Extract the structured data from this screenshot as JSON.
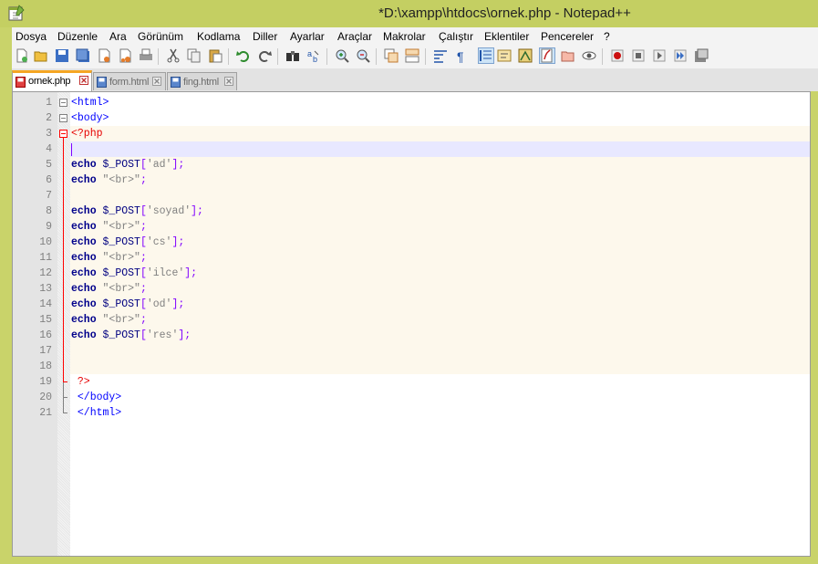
{
  "window": {
    "title": "*D:\\xampp\\htdocs\\ornek.php - Notepad++",
    "app_icon": "notepad-plus-plus-icon"
  },
  "menu": [
    "Dosya",
    "Düzenle",
    "Ara",
    "Görünüm",
    "Kodlama",
    "Diller",
    "Ayarlar",
    "Araçlar",
    "Makrolar",
    "Çalıştır",
    "Eklentiler",
    "Pencereler",
    "?"
  ],
  "toolbar": {
    "buttons": [
      "new-file-icon",
      "open-file-icon",
      "save-icon",
      "save-all-icon",
      "close-icon",
      "close-all-icon",
      "print-icon",
      "cut-icon",
      "copy-icon",
      "paste-icon",
      "undo-icon",
      "redo-icon",
      "find-icon",
      "replace-icon",
      "zoom-in-icon",
      "zoom-out-icon",
      "sync-vertical-icon",
      "sync-horizontal-icon",
      "word-wrap-icon",
      "show-all-chars-icon",
      "indent-guide-icon",
      "user-lang-icon",
      "doc-map-icon",
      "function-list-icon",
      "folder-workspace-icon",
      "monitor-icon",
      "record-macro-icon",
      "stop-record-icon",
      "play-macro-icon",
      "run-macro-multiple-icon",
      "save-macro-icon"
    ]
  },
  "tabs": [
    {
      "label": "ornek.php",
      "active": true
    },
    {
      "label": "form.html",
      "active": false
    },
    {
      "label": "fing.html",
      "active": false
    }
  ],
  "editor": {
    "current_line": 4,
    "lines": [
      {
        "n": "1",
        "text": "<html>"
      },
      {
        "n": "2",
        "text": "<body>"
      },
      {
        "n": "3",
        "text": "<?php"
      },
      {
        "n": "4",
        "text": ""
      },
      {
        "n": "5",
        "text": "echo $_POST['ad'];"
      },
      {
        "n": "6",
        "text": "echo \"<br>\";"
      },
      {
        "n": "7",
        "text": ""
      },
      {
        "n": "8",
        "text": "echo $_POST['soyad'];"
      },
      {
        "n": "9",
        "text": "echo \"<br>\";"
      },
      {
        "n": "10",
        "text": "echo $_POST['cs'];"
      },
      {
        "n": "11",
        "text": "echo \"<br>\";"
      },
      {
        "n": "12",
        "text": "echo $_POST['ilce'];"
      },
      {
        "n": "13",
        "text": "echo \"<br>\";"
      },
      {
        "n": "14",
        "text": "echo $_POST['od'];"
      },
      {
        "n": "15",
        "text": "echo \"<br>\";"
      },
      {
        "n": "16",
        "text": "echo $_POST['res'];"
      },
      {
        "n": "17",
        "text": ""
      },
      {
        "n": "18",
        "text": ""
      },
      {
        "n": "19",
        "text": " ?>"
      },
      {
        "n": "20",
        "text": " </body>"
      },
      {
        "n": "21",
        "text": " </html>"
      }
    ]
  },
  "colors": {
    "titlebar": "#c4cf62",
    "keyword": "#00008b",
    "tag": "#0000ff",
    "php_delimiter": "#e60000",
    "string": "#808080",
    "current_line": "#e8e8ff",
    "php_block_bg": "#fdf8ec"
  }
}
